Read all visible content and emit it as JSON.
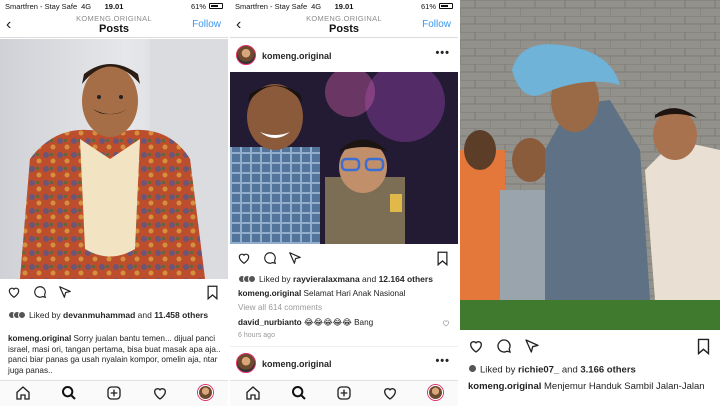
{
  "status": {
    "carrier": "Smartfren - Stay Safe",
    "network": "4G",
    "time": "19.01",
    "battery": "61%"
  },
  "nav": {
    "username": "KOMENG.ORIGINAL",
    "title": "Posts",
    "follow": "Follow"
  },
  "panel1": {
    "liked_by_prefix": "Liked by ",
    "liked_by_user": "devanmuhammad",
    "and": " and ",
    "likes_count": "11.458 others",
    "caption_user": "komeng.original",
    "caption_text": " Sorry jualan bantu temen... dijual panci israel, masi ori, tangan pertama, bisa buat masak apa aja.. panci biar panas ga usah nyalain kompor, omelin aja, ntar juga panas.."
  },
  "panel2": {
    "header_user": "komeng.original",
    "liked_by_prefix": "Liked by ",
    "liked_by_user": "rayvieralaxmana",
    "and": " and ",
    "likes_count": "12.164 others",
    "caption_user": "komeng.original",
    "caption_text": " Selamat Hari Anak Nasional",
    "view_comments": "View all 614 comments",
    "comment_user": "david_nurbianto",
    "comment_text": " 😂😂😂😂😂 Bang",
    "time_ago": "6 hours ago",
    "next_user": "komeng.original"
  },
  "panel3": {
    "liked_by_prefix": "Liked by ",
    "liked_by_user": "richie07_",
    "and": " and ",
    "likes_count": "3.166 others",
    "caption_user": "komeng.original",
    "caption_text": " Menjemur Handuk Sambil Jalan-Jalan"
  },
  "colors": {
    "link": "#3897f0",
    "text": "#262626",
    "muted": "#8e8e8e",
    "story_ring": "#e1306c"
  },
  "icons": [
    "back-chevron-icon",
    "heart-icon",
    "comment-icon",
    "share-icon",
    "bookmark-icon",
    "more-icon",
    "home-icon",
    "search-icon",
    "add-icon",
    "activity-icon",
    "profile-avatar-icon"
  ]
}
